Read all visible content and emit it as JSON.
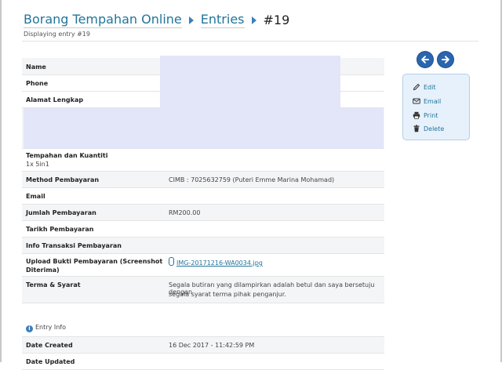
{
  "header": {
    "breadcrumb_root": "Borang Tempahan Online",
    "breadcrumb_entries": "Entries",
    "breadcrumb_current": "#19",
    "subtitle": "Displaying entry #19"
  },
  "entry": {
    "name_label": "Name",
    "phone_label": "Phone",
    "address_label": "Alamat Lengkap",
    "order_label": "Tempahan dan Kuantiti",
    "order_value": "1x 5in1",
    "payment_method_label": "Method Pembayaran",
    "payment_method_value": "CIMB : 7025632759 (Puteri Emme Marina Mohamad)",
    "email_label": "Email",
    "amount_label": "Jumlah Pembayaran",
    "amount_value": "RM200.00",
    "payment_date_label": "Tarikh Pembayaran",
    "transaction_info_label": "Info Transaksi Pembayaran",
    "upload_label_line1": "Upload Bukti Pembayaran (Screenshot",
    "upload_label_line2": "Diterima)",
    "upload_file": "IMG-20171216-WA0034.jpg",
    "terms_label": "Terma & Syarat",
    "terms_line1": "Segala butiran yang dilampirkan adalah betul dan saya bersetuju dengan",
    "terms_line2": "segala syarat terma pihak penganjur."
  },
  "entry_info": {
    "title": "Entry Info",
    "date_created_label": "Date Created",
    "date_created_value": "16 Dec 2017 - 11:42:59 PM",
    "date_updated_label": "Date Updated"
  },
  "actions": {
    "edit": "Edit",
    "email": "Email",
    "print": "Print",
    "delete": "Delete"
  },
  "colors": {
    "link": "#21759b",
    "nav_button": "#2b65b0",
    "redaction": "#e3e5f8",
    "panel_bg": "#e7f1fb"
  }
}
